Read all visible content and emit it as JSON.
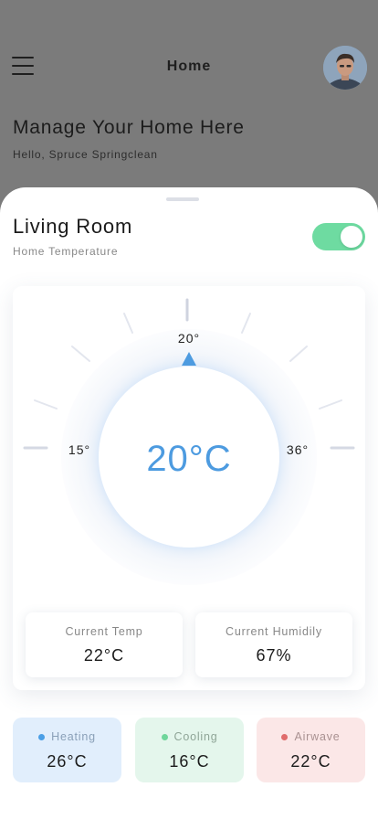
{
  "header": {
    "title": "Home",
    "heading": "Manage Your Home Here",
    "greeting": "Hello, Spruce Springclean"
  },
  "room": {
    "name": "Living Room",
    "subtitle": "Home Temperature",
    "power_on": true
  },
  "thermostat": {
    "min_label": "15°",
    "max_label": "36°",
    "setpoint_label": "20°",
    "center_label": "20°C",
    "accent_color": "#4d9be0"
  },
  "stats": {
    "current_temp_label": "Current Temp",
    "current_temp_value": "22°C",
    "current_humidity_label": "Current Humidily",
    "current_humidity_value": "67%"
  },
  "modes": [
    {
      "label": "Heating",
      "value": "26°C",
      "dot_color": "#4b9fe6",
      "bg_color": "#e1eefc",
      "text_color": "#8aa0b8"
    },
    {
      "label": "Cooling",
      "value": "16°C",
      "dot_color": "#6fd69b",
      "bg_color": "#e4f6ec",
      "text_color": "#8fa597"
    },
    {
      "label": "Airwave",
      "value": "22°C",
      "dot_color": "#e06c6c",
      "bg_color": "#fbe7e7",
      "text_color": "#a99191"
    }
  ],
  "icons": {
    "menu": "menu-icon",
    "avatar": "avatar",
    "pointer": "triangle-pointer-icon"
  }
}
